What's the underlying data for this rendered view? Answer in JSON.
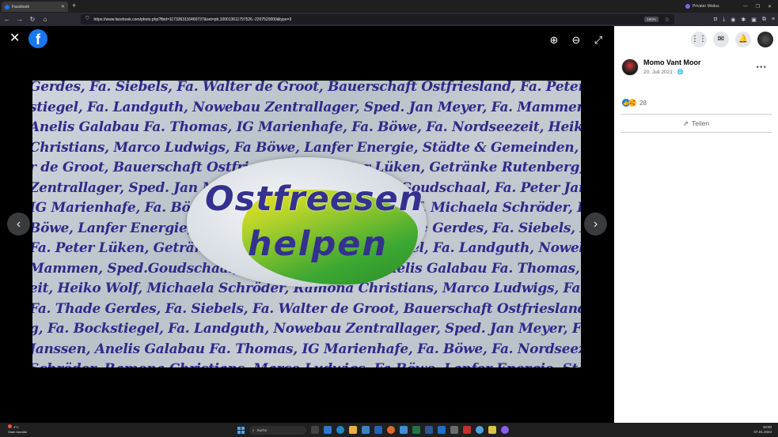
{
  "browser": {
    "tab_title": "Facebook",
    "new_tab_glyph": "+",
    "private_label": "Privater Modus",
    "url": "https://www.facebook.com/photo.php?fbid=1173363116460737&set=pb.100013611797526.-2207520000&type=3",
    "zoom": "150%"
  },
  "viewer": {
    "close_glyph": "✕",
    "logo_glyph": "f",
    "zoom_in_glyph": "⊕",
    "zoom_out_glyph": "⊖",
    "fullscreen_glyph": "⤢",
    "prev_glyph": "‹",
    "next_glyph": "›",
    "photo": {
      "logo_line1": "Ostfreesen",
      "logo_line2": "helpen",
      "background_lines": [
        "Gerdes, Fa. Siebels, Fa. Walter de Groot, Bauerschaft Ostfriesland, Fa. Peter Lüken, Getränke",
        "stiegel, Fa. Landguth, Nowebau Zentrallager, Sped. Jan Meyer, Fa. Mammen, Sped.Goudschaal, M",
        "Anelis Galabau Fa. Thomas, IG Marienhafe, Fa. Böwe, Fa. Nordseezeit, Heiko Wolf, Michaela",
        "Christians, Marco Ludwigs, Fa Böwe, Lanfer Energie, Städte & Gemeinden, Fa. Thade Gerdes, Fa",
        "r de Groot, Bauerschaft Ostfriesland, Fa. Peter Lüken, Getränke Rutenberg, Fa. Bockstiegel, Fa. La",
        "Zentrallager, Sped. Jan Meyer, Fa. Mammen, Sped.Goudschaal, Fa. Peter Janssen, Anelis Gala",
        "IG Marienhafe, Fa. Böwe, Fa. Nordseezeit, Heiko Wolf, Michaela Schröder, Ramona Christians,",
        "Böwe, Lanfer Energie, Städte & Gemeinden, Fa. Thade Gerdes, Fa. Siebels, Fa. Walter de Groot, B",
        "Fa. Peter Lüken, Getränke Rutenberg, Fa. Bockstiegel, Fa. Landguth, Nowebau Zentrallager, Sped",
        "Mammen, Sped.Goudschaal, Fa. Peter Janssen, Anelis Galabau Fa. Thomas, IG Marienhafe, Fa",
        "eit, Heiko Wolf, Michaela Schröder, Ramona Christians, Marco Ludwigs, Fa Böwe, Lanfer Energi",
        "Fa. Thade Gerdes, Fa. Siebels, Fa. Walter de Groot, Bauerschaft Ostfriesland, Fa. Peter Lüken",
        "g, Fa. Bockstiegel, Fa. Landguth, Nowebau Zentrallager, Sped. Jan Meyer, Fa. Mammen, Sped.Gou",
        "Janssen, Anelis Galabau Fa. Thomas, IG Marienhafe, Fa. Böwe, Fa. Nordseezeit, Heiko Wolf, Mi",
        "Schröder, Ramona Christians, Marco Ludwigs, Fa Böwe, Lanfer Energie, Städte & Gemeinden"
      ]
    }
  },
  "panel": {
    "author": "Momo Vant Moor",
    "date": "20. Juli 2021 · 🌐",
    "more_glyph": "•••",
    "reaction_count": "28",
    "share_label": "Teilen",
    "share_glyph": "⇗"
  },
  "taskbar": {
    "weather_temp": "4°C",
    "weather_desc": "Stark bewölkt",
    "search_placeholder": "Suche",
    "time": "18:00",
    "date": "07.01.2024"
  },
  "colors": {
    "facebook_blue": "#1877f2",
    "viewer_bg": "#000000",
    "logo_text": "#34318f"
  }
}
